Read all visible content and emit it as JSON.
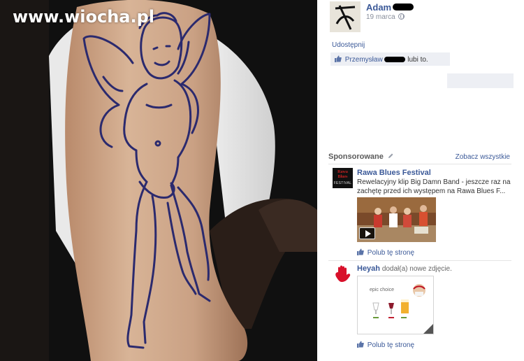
{
  "watermark": "www.wiocha.pl",
  "post": {
    "author": "Adam",
    "date": "19 marca",
    "share_label": "Udostępnij",
    "liker_name": "Przemysław",
    "likes_suffix": "lubi to."
  },
  "sponsored": {
    "header": "Sponsorowane",
    "see_all": "Zobacz wszystkie",
    "ads": [
      {
        "logo_top": "Rawa Blues",
        "logo_bottom": "FESTIVAL",
        "title": "Rawa Blues Festival",
        "text": "Rewelacyjny klip Big Damn Band - jeszcze raz na zachętę przed ich występem na Rawa Blues F...",
        "like_label": "Polub tę stronę"
      },
      {
        "title": "Heyah",
        "action": "dodał(a) nowe zdjęcie.",
        "card_text": "epic choice",
        "like_label": "Polub tę stronę"
      }
    ]
  },
  "colors": {
    "link": "#3b5998",
    "box_bg": "#edeff4",
    "photo_bg": "#0d0d0d",
    "heyah_red": "#d8102a"
  }
}
